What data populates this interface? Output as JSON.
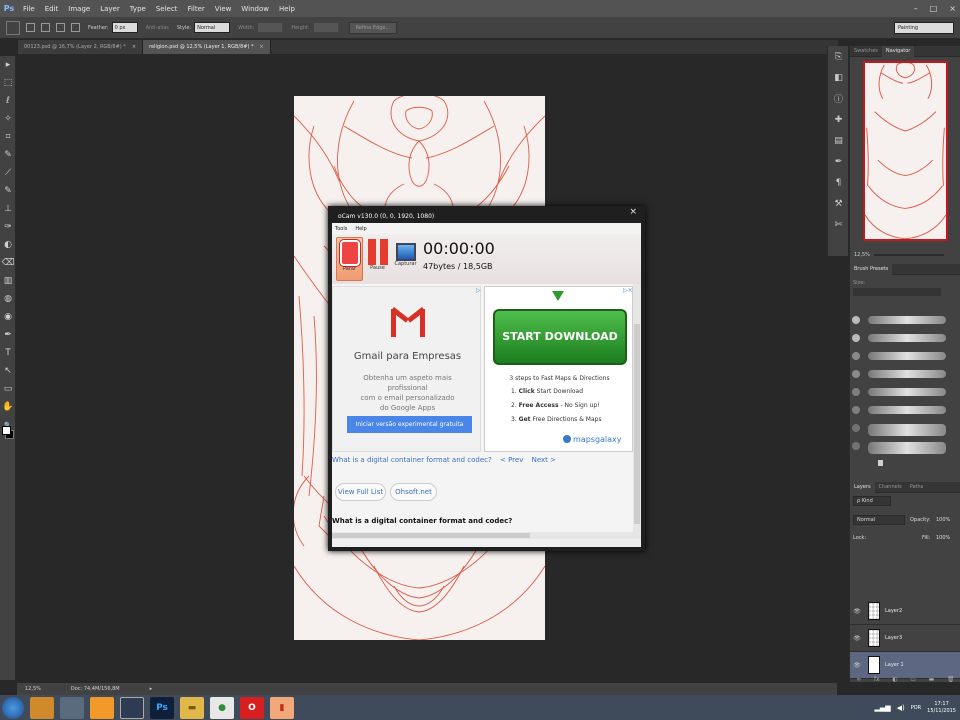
{
  "app": {
    "logo": "Ps"
  },
  "menu": [
    "File",
    "Edit",
    "Image",
    "Layer",
    "Type",
    "Select",
    "Filter",
    "View",
    "Window",
    "Help"
  ],
  "window_controls": [
    "–",
    "□",
    "×"
  ],
  "options": {
    "feather_label": "Feather:",
    "feather_value": "0 px",
    "antialias_label": "Anti-alias",
    "style_label": "Style:",
    "style_value": "Normal",
    "width_label": "Width:",
    "height_label": "Height:",
    "refine_label": "Refine Edge...",
    "workspace": "Painting"
  },
  "tabs": [
    {
      "label": "00123.psd @ 16,7% (Layer 2, RGB/8#) *",
      "close": "×"
    },
    {
      "label": "religion.psd @ 12,5% (Layer 1, RGB/8#) *",
      "close": "×"
    }
  ],
  "tools": [
    "▸",
    "⬚",
    "ℓ",
    "✧",
    "⌗",
    "✎",
    "⟋",
    "✎",
    "⊥",
    "✑",
    "◐",
    "⌫",
    "▥",
    "◍",
    "◉",
    "✒",
    "T",
    "↖",
    "▭",
    "✋",
    "🔍"
  ],
  "status": {
    "zoom": "12,5%",
    "doc": "Doc: 74,4M/156,8M",
    "arrow": "▸"
  },
  "panel_strip": [
    "⎘",
    "◧",
    "ⓘ",
    "✚",
    "▤",
    "✒",
    "¶",
    "⚒",
    "✄"
  ],
  "navigator": {
    "tabs": [
      "Swatches",
      "Navigator"
    ],
    "zoom": "12,5%"
  },
  "brush_presets": {
    "tab": "Brush Presets",
    "size_label": "Size:"
  },
  "layers": {
    "tabs": [
      "Layers",
      "Channels",
      "Paths"
    ],
    "kind": "ρ Kind",
    "blend_mode": "Normal",
    "opacity_label": "Opacity:",
    "opacity_value": "100%",
    "lock_label": "Lock:",
    "fill_label": "Fill:",
    "fill_value": "100%",
    "items": [
      {
        "name": "Layer2",
        "eye": "👁"
      },
      {
        "name": "Layer3",
        "eye": "👁"
      },
      {
        "name": "Layer 1",
        "eye": "👁"
      }
    ],
    "footer": [
      "∞",
      "fx",
      "◐",
      "▭",
      "▬",
      "🗑"
    ]
  },
  "ocam": {
    "title": "oCam v130.0 (0, 0, 1920, 1080)",
    "close": "×",
    "menu": [
      "Tools",
      "Help"
    ],
    "buttons": {
      "stop": "Parar",
      "pause": "Pause",
      "capture": "Capturar"
    },
    "timer": "00:00:00",
    "bytes": "47bytes / 18,5GB",
    "ad_gmail": {
      "title": "Gmail para Empresas",
      "desc": "Obtenha um aspeto mais profissional\ncom o email personalizado\ndo Google Apps",
      "cta": "Iniciar versão experimental gratuita",
      "ad_choices": "▷"
    },
    "ad_download": {
      "button": "START DOWNLOAD",
      "heading": "3 steps to Fast Maps & Directions",
      "steps": [
        {
          "num": "1.",
          "bold": "Click",
          "rest": " Start Download"
        },
        {
          "num": "2.",
          "bold": "Free Access",
          "rest": " - No Sign up!"
        },
        {
          "num": "3.",
          "bold": "Get",
          "rest": " Free Directions & Maps"
        }
      ],
      "brand": "mapsgalaxy",
      "ad_choices": "▷×"
    },
    "link_line": {
      "link": "What is a digital container format and codec?",
      "prev": "< Prev",
      "next": "Next >"
    },
    "btn_view_full": "View Full List",
    "btn_ohsoft": "Ohsoft.net",
    "question": "What is a digital container format and codec?"
  },
  "taskbar": {
    "apps": [
      {
        "name": "ps-app",
        "label": "Ps",
        "bg": "#0e1f3a",
        "fg": "#3ea8ff"
      },
      {
        "name": "explorer-app",
        "label": "▬",
        "bg": "#e2b84a",
        "fg": "#7a5a10"
      },
      {
        "name": "chrome-app",
        "label": "●",
        "bg": "#e8e8e8",
        "fg": "#2f8d3a"
      },
      {
        "name": "opera-app",
        "label": "O",
        "bg": "#d71f1f",
        "fg": "#ffffff"
      },
      {
        "name": "ocam-app",
        "label": "▮",
        "bg": "#f2a97a",
        "fg": "#c12b1c"
      }
    ],
    "lang": "POR",
    "time": "17:17",
    "date": "15/11/2015"
  }
}
